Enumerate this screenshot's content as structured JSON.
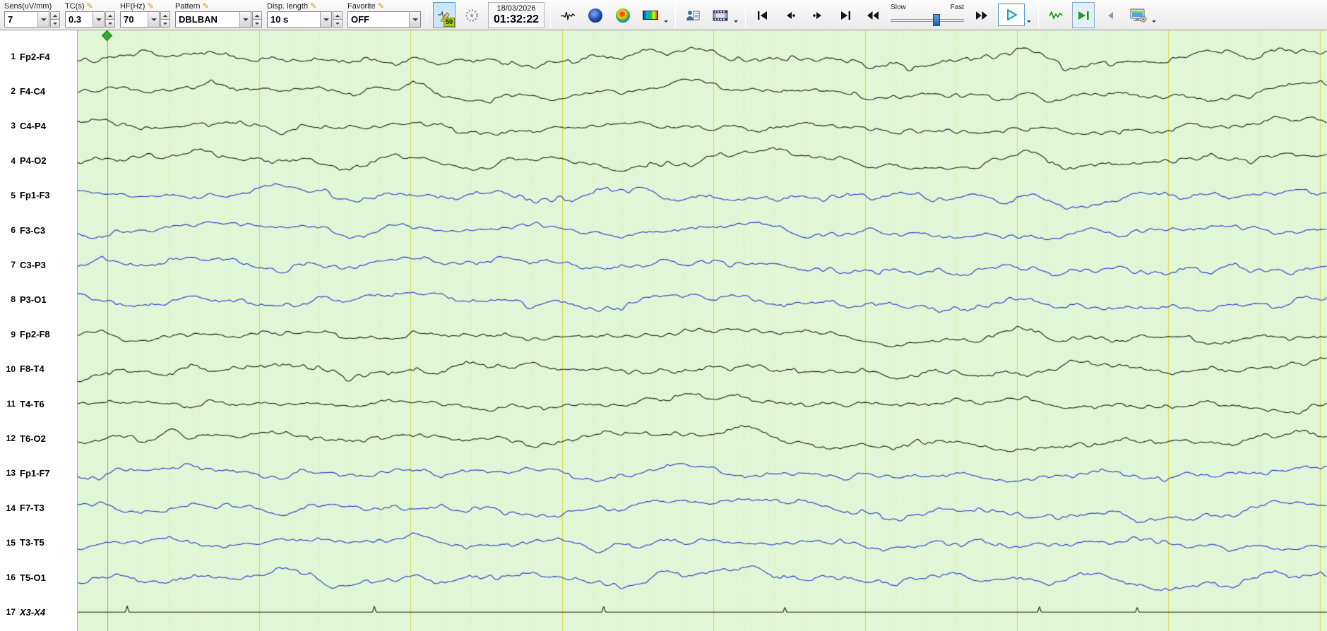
{
  "toolbar": {
    "sens": {
      "label": "Sens(uV/mm)",
      "value": "7"
    },
    "tc": {
      "label": "TC(s)",
      "value": "0.3"
    },
    "hf": {
      "label": "HF(Hz)",
      "value": "70"
    },
    "pattern": {
      "label": "Pattern",
      "value": "DBLBAN"
    },
    "disp_length": {
      "label": "Disp. length",
      "value": "10 s"
    },
    "favorite": {
      "label": "Favorite",
      "value": "OFF"
    },
    "notch_value": "50",
    "date": "18/03/2026",
    "time": "01:32:22",
    "speed": {
      "slow": "Slow",
      "fast": "Fast"
    }
  },
  "icons": {
    "pencil": "✎"
  },
  "channels": [
    {
      "num": 1,
      "label": "Fp2-F4",
      "color": "#1a1a1a",
      "italic": false,
      "flat": false
    },
    {
      "num": 2,
      "label": "F4-C4",
      "color": "#1a1a1a",
      "italic": false,
      "flat": false
    },
    {
      "num": 3,
      "label": "C4-P4",
      "color": "#1a1a1a",
      "italic": false,
      "flat": false
    },
    {
      "num": 4,
      "label": "P4-O2",
      "color": "#1a1a1a",
      "italic": false,
      "flat": false
    },
    {
      "num": 5,
      "label": "Fp1-F3",
      "color": "#2236cc",
      "italic": false,
      "flat": false
    },
    {
      "num": 6,
      "label": "F3-C3",
      "color": "#2236cc",
      "italic": false,
      "flat": false
    },
    {
      "num": 7,
      "label": "C3-P3",
      "color": "#2236cc",
      "italic": false,
      "flat": false
    },
    {
      "num": 8,
      "label": "P3-O1",
      "color": "#2236cc",
      "italic": false,
      "flat": false
    },
    {
      "num": 9,
      "label": "Fp2-F8",
      "color": "#1a1a1a",
      "italic": false,
      "flat": false
    },
    {
      "num": 10,
      "label": "F8-T4",
      "color": "#1a1a1a",
      "italic": false,
      "flat": false
    },
    {
      "num": 11,
      "label": "T4-T6",
      "color": "#1a1a1a",
      "italic": false,
      "flat": false
    },
    {
      "num": 12,
      "label": "T6-O2",
      "color": "#1a1a1a",
      "italic": false,
      "flat": false
    },
    {
      "num": 13,
      "label": "Fp1-F7",
      "color": "#2236cc",
      "italic": false,
      "flat": false
    },
    {
      "num": 14,
      "label": "F7-T3",
      "color": "#2236cc",
      "italic": false,
      "flat": false
    },
    {
      "num": 15,
      "label": "T3-T5",
      "color": "#2236cc",
      "italic": false,
      "flat": false
    },
    {
      "num": 16,
      "label": "T5-O1",
      "color": "#2236cc",
      "italic": false,
      "flat": false
    },
    {
      "num": 17,
      "label": "X3-X4",
      "color": "#1a1a1a",
      "italic": true,
      "flat": true
    }
  ],
  "display": {
    "background": "#e0f6d6",
    "grid_major_color": "#e0da3c",
    "grid_minor_color": "#e9e67f",
    "marker_color": "#35a935",
    "marker_line_color": "rgba(100,112,100,0.5)"
  }
}
